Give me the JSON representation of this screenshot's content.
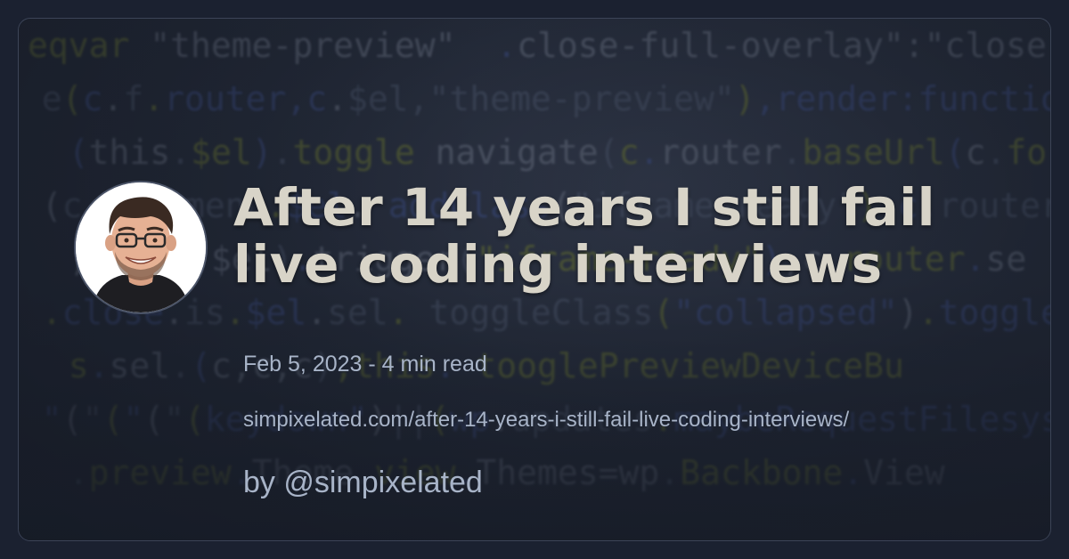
{
  "post": {
    "title_line1": "After 14 years I still fail",
    "title_line2": "live coding interviews",
    "meta": "Feb 5, 2023 - 4 min read",
    "url": "simpixelated.com/after-14-years-i-still-fail-live-coding-interviews/",
    "byline": "by @simpixelated"
  },
  "avatar": {
    "icon": "author-avatar-icon"
  },
  "background": {
    "code_lines": [
      "eqvar \"theme-preview\"  .close-full-overlay\":\"close\",",
      "  e(c.f.router,c.$el,\"theme-preview\"),render:function(){var b,c",
      "  (this.$el).toggle navigate(c.router.baseUrl(c.form",
      "  (c.f,e.menu.$el. addClass(\"iframe-ready\"),c.router",
      "  ;(this.$el).trigger(\"iframe-ready\"),c.router.se",
      "  .close.is.$el.sel. toggleClass(\"collapsed\").toggleCl",
      "  s.sel.(c,c,c),this. tooglePreviewDeviceBu",
      "  \"(\"(\"(\"(keydown\")||(wp.updates.maybeRequestFilesys",
      "  .preview.Theme.view.Themes=wp.Backbone.View"
    ]
  },
  "colors": {
    "page_bg": "#1b2130",
    "title_text": "#d8d4c8",
    "meta_text": "#a8b4c8",
    "card_border": "#3c4457"
  }
}
